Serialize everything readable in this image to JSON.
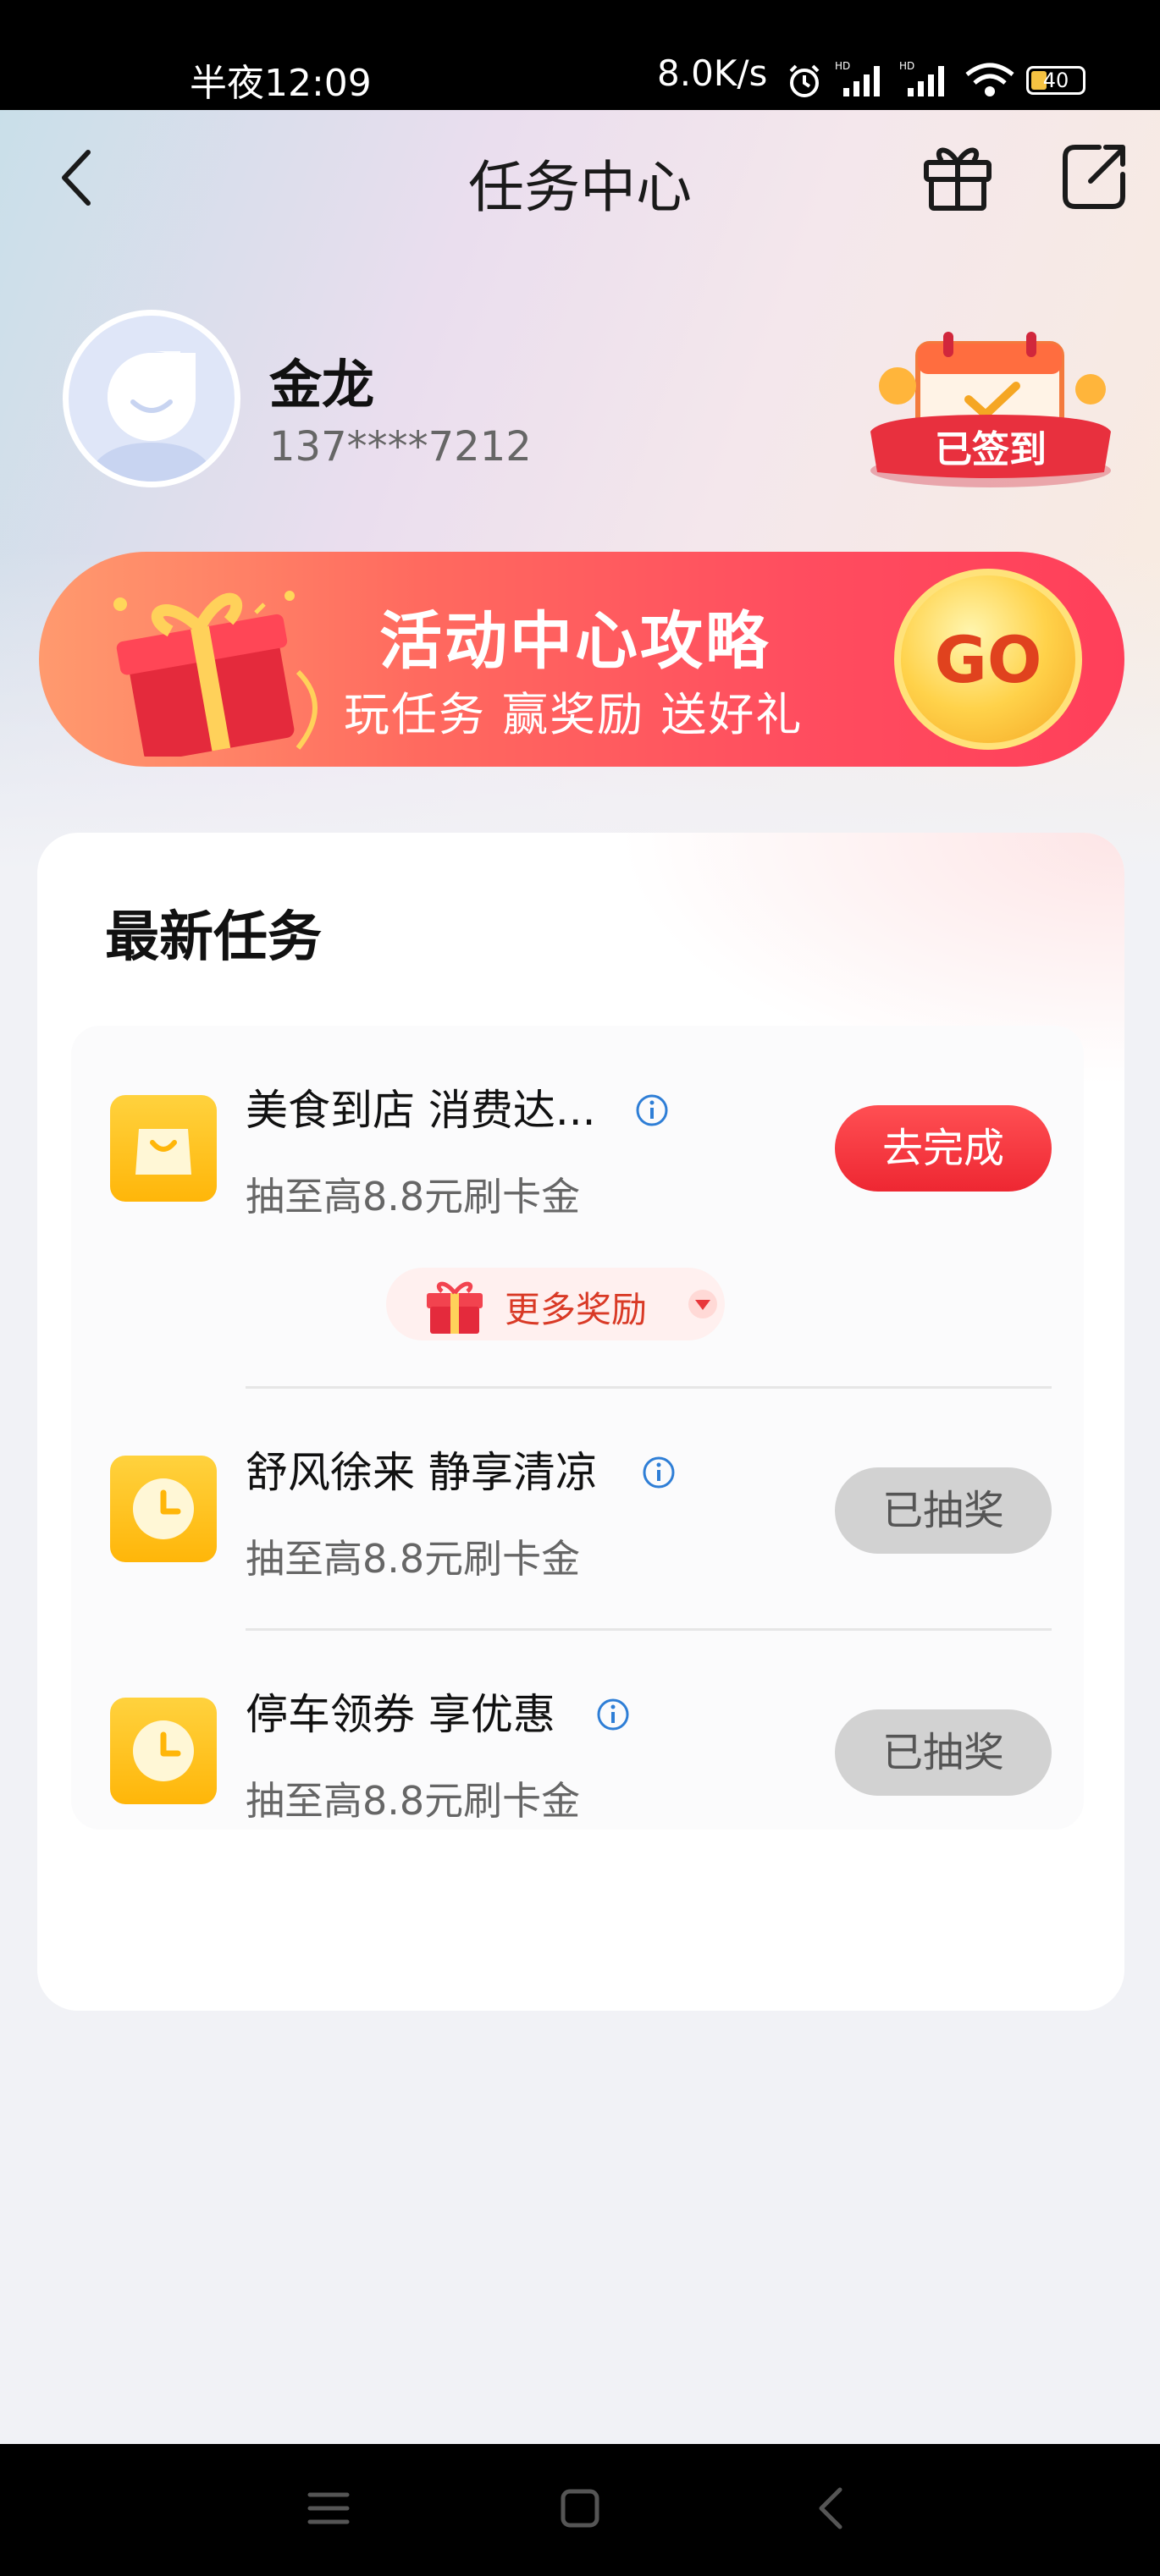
{
  "status_bar": {
    "time": "半夜12:09",
    "speed": "8.0K/s",
    "battery": "40"
  },
  "nav": {
    "title": "任务中心"
  },
  "user": {
    "name": "金龙",
    "phone": "137****7212",
    "checkin_label": "已签到"
  },
  "banner": {
    "title": "活动中心攻略",
    "subtitle": "玩任务 赢奖励 送好礼",
    "go_label": "GO"
  },
  "section": {
    "title": "最新任务"
  },
  "tasks": [
    {
      "title": "美食到店 消费达...",
      "subtitle": "抽至高8.8元刷卡金",
      "button": "去完成",
      "status": "active",
      "icon": "shopping-bag-icon"
    },
    {
      "title": "舒风徐来 静享清凉",
      "subtitle": "抽至高8.8元刷卡金",
      "button": "已抽奖",
      "status": "done",
      "icon": "clock-icon"
    },
    {
      "title": "停车领券 享优惠",
      "subtitle": "抽至高8.8元刷卡金",
      "button": "已抽奖",
      "status": "done",
      "icon": "clock-icon"
    }
  ],
  "more_rewards": {
    "label": "更多奖励"
  },
  "colors": {
    "accent_red": "#ee2732",
    "icon_yellow": "#ffb609",
    "banner_red": "#ff4d5f"
  }
}
